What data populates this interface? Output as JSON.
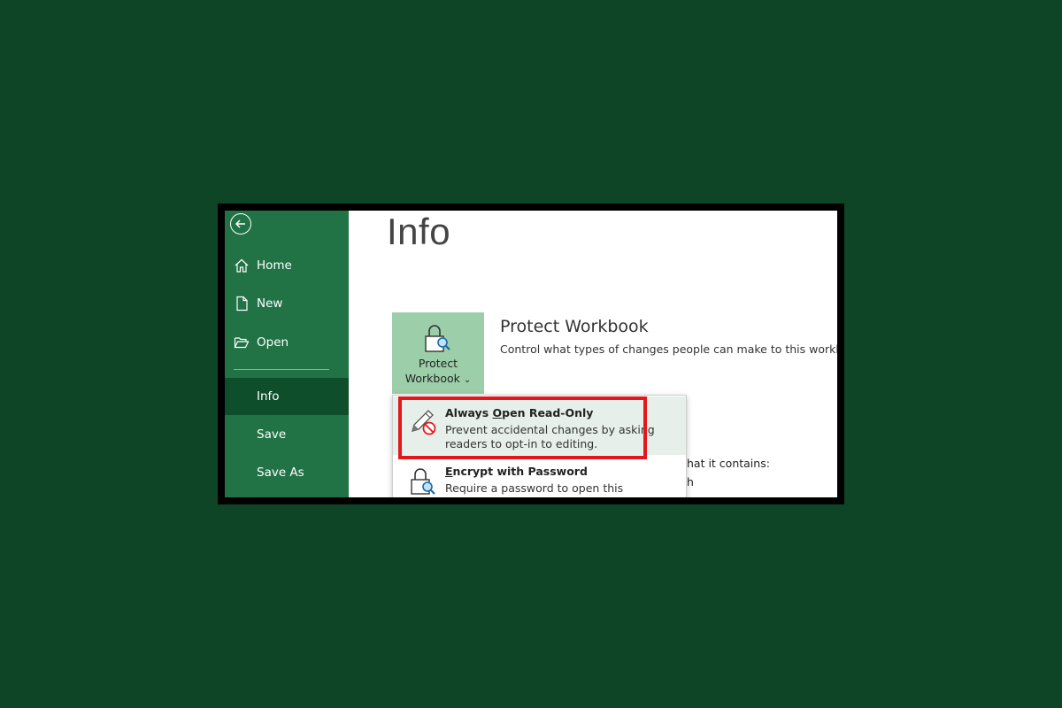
{
  "sidebar": {
    "back_label": "Back",
    "items": [
      {
        "label": "Home",
        "icon": "home-icon"
      },
      {
        "label": "New",
        "icon": "new-document-icon"
      },
      {
        "label": "Open",
        "icon": "open-folder-icon"
      },
      {
        "label": "Info",
        "active": true
      },
      {
        "label": "Save"
      },
      {
        "label": "Save As"
      }
    ]
  },
  "main": {
    "title": "Info",
    "protect_button": {
      "line1": "Protect",
      "line2": "Workbook",
      "chevron": "⌄"
    },
    "section_title": "Protect Workbook",
    "section_desc": "Control what types of changes people can make to this workbook.",
    "behind_text_1": "hat it contains:",
    "behind_text_2": "h"
  },
  "menu": {
    "items": [
      {
        "title_pre": "Always ",
        "title_access": "O",
        "title_post": "pen Read-Only",
        "desc": "Prevent accidental changes by asking readers to opt-in to editing.",
        "icon": "pencil-prohibited-icon"
      },
      {
        "title_pre": "",
        "title_access": "E",
        "title_post": "ncrypt with Password",
        "desc": "Require a password to open this workbook.",
        "icon": "lock-key-icon"
      }
    ]
  },
  "colors": {
    "background": "#0d4526",
    "sidebar": "#217346",
    "sidebar_active": "#0e4e2a",
    "protect_button": "#9ccfa9",
    "highlight": "#e4181c"
  }
}
